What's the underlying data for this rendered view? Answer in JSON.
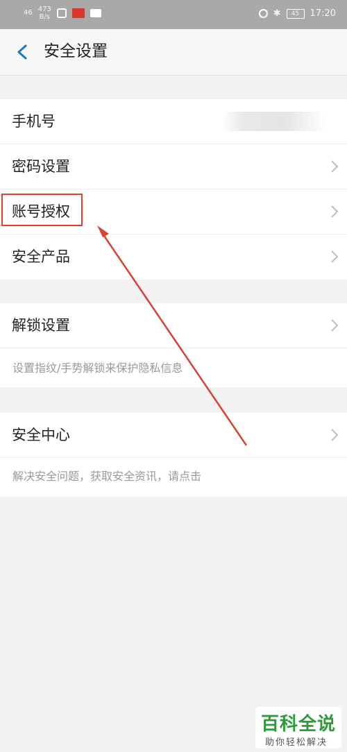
{
  "status_bar": {
    "signal": "46",
    "net_speed_value": "473",
    "net_speed_unit": "B/s",
    "battery": "45",
    "time": "17:20"
  },
  "header": {
    "title": "安全设置"
  },
  "groups": [
    {
      "items": [
        {
          "label": "手机号"
        },
        {
          "label": "密码设置"
        },
        {
          "label": "账号授权"
        },
        {
          "label": "安全产品"
        }
      ]
    },
    {
      "items": [
        {
          "label": "解锁设置"
        }
      ],
      "description": "设置指纹/手势解锁来保护隐私信息"
    },
    {
      "items": [
        {
          "label": "安全中心"
        }
      ],
      "description": "解决安全问题，获取安全资讯，请点击"
    }
  ],
  "watermark": {
    "title": "百科全说",
    "subtitle": "助你轻松解决"
  },
  "colors": {
    "accent_blue": "#1e78c8",
    "highlight_red": "#d9402e",
    "watermark_green": "#2e9a3a"
  }
}
